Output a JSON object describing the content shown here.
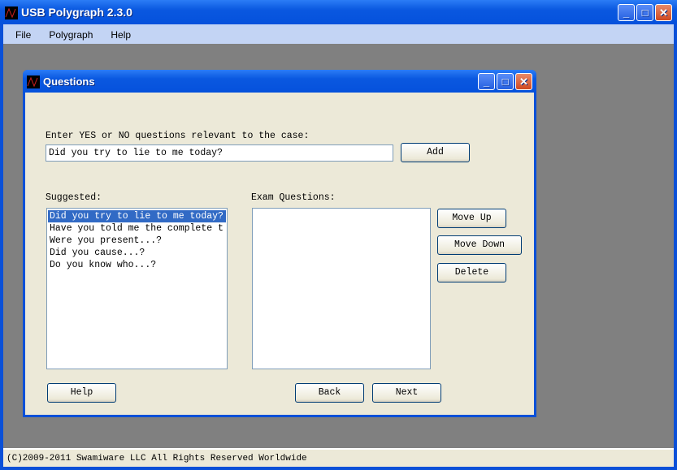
{
  "app": {
    "title": "USB Polygraph 2.3.0",
    "menu": [
      "File",
      "Polygraph",
      "Help"
    ],
    "status": "(C)2009-2011 Swamiware LLC All Rights Reserved Worldwide"
  },
  "dialog": {
    "title": "Questions",
    "prompt": "Enter YES or NO questions relevant to the case:",
    "input_value": "Did you try to lie to me today?",
    "add": "Add",
    "suggested_label": "Suggested:",
    "suggested": [
      "Did you try to lie to me today?",
      "Have you told me the complete t",
      "Were you present...?",
      "Did you cause...?",
      "Do you know who...?"
    ],
    "selected_index": 0,
    "exam_label": "Exam Questions:",
    "exam_questions": [],
    "move_up": "Move Up",
    "move_down": "Move Down",
    "delete": "Delete",
    "help": "Help",
    "back": "Back",
    "next": "Next"
  },
  "icons": {
    "minimize": "minimize-icon",
    "maximize": "maximize-icon",
    "close": "close-icon"
  }
}
